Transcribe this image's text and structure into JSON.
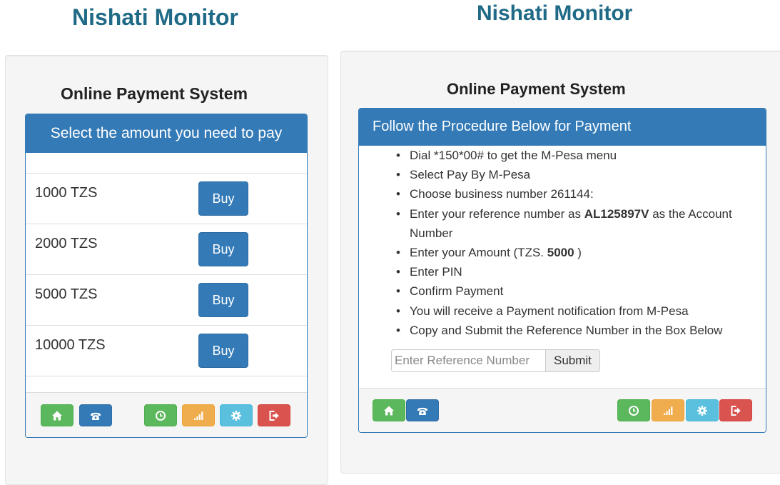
{
  "left": {
    "title": "Nishati Monitor",
    "subtitle": "Online Payment System",
    "panel_heading": "Select the amount you need to pay",
    "amounts": [
      {
        "label": "1000 TZS",
        "button": "Buy"
      },
      {
        "label": "2000 TZS",
        "button": "Buy"
      },
      {
        "label": "5000 TZS",
        "button": "Buy"
      },
      {
        "label": "10000 TZS",
        "button": "Buy"
      }
    ]
  },
  "right": {
    "title": "Nishati Monitor",
    "subtitle": "Online Payment System",
    "panel_heading": "Follow the Procedure Below for Payment",
    "steps": {
      "s1": "Dial *150*00# to get the M-Pesa menu",
      "s2": "Select Pay By M-Pesa",
      "s3": "Choose business number 261144:",
      "s4_pre": "Enter your reference number as ",
      "s4_ref": "AL125897V",
      "s4_post": " as the Account Number",
      "s5_pre": "Enter your Amount (TZS. ",
      "s5_amount": "5000",
      "s5_post": " )",
      "s6": "Enter PIN",
      "s7": "Confirm Payment",
      "s8": "You will receive a Payment notification from M-Pesa",
      "s9": "Copy and Submit the Reference Number in the Box Below"
    },
    "reference_input": {
      "placeholder": "Enter Reference Number",
      "value": ""
    },
    "submit_label": "Submit"
  },
  "footer_icons": [
    "home-icon",
    "phone-icon",
    "clock-icon",
    "signal-icon",
    "gear-icon",
    "logout-icon"
  ],
  "colors": {
    "title": "#1f6a86",
    "primary": "#337ab7",
    "success": "#5cb85c",
    "warning": "#f0ad4e",
    "info": "#5bc0de",
    "danger": "#d9534f"
  }
}
